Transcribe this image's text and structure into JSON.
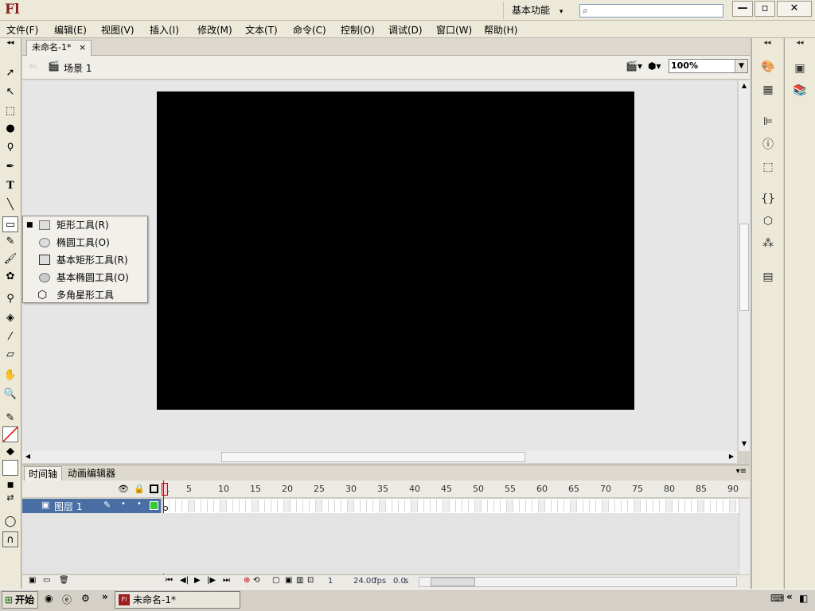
{
  "app": {
    "logo": "Fl",
    "workspace_label": "基本功能",
    "search_placeholder": ""
  },
  "window_controls": {
    "minimize": "—",
    "restore": "▫",
    "close": "✕"
  },
  "menubar": {
    "items": [
      "文件(F)",
      "编辑(E)",
      "视图(V)",
      "插入(I)",
      "修改(M)",
      "文本(T)",
      "命令(C)",
      "控制(O)",
      "调试(D)",
      "窗口(W)",
      "帮助(H)"
    ]
  },
  "document": {
    "tab_title": "未命名-1*",
    "tab_close": "×",
    "scene_label": "场景 1",
    "zoom": "100%"
  },
  "stage": {
    "background_color": "#000000"
  },
  "tool_popup": {
    "items": [
      {
        "label": "矩形工具(R)",
        "icon": "rectangle-icon",
        "selected": true
      },
      {
        "label": "椭圆工具(O)",
        "icon": "oval-icon",
        "selected": false
      },
      {
        "label": "基本矩形工具(R)",
        "icon": "primitive-rectangle-icon",
        "selected": false
      },
      {
        "label": "基本椭圆工具(O)",
        "icon": "primitive-oval-icon",
        "selected": false
      },
      {
        "label": "多角星形工具",
        "icon": "polystar-icon",
        "selected": false
      }
    ]
  },
  "timeline": {
    "tabs": [
      "时间轴",
      "动画编辑器"
    ],
    "frame_numbers": [
      "1",
      "5",
      "10",
      "15",
      "20",
      "25",
      "30",
      "35",
      "40",
      "45",
      "50",
      "55",
      "60",
      "65",
      "70",
      "75",
      "80",
      "85",
      "90"
    ],
    "layer_name": "图层 1",
    "current_frame": "1",
    "fps": "24.00",
    "fps_unit": "fps",
    "time": "0.0",
    "time_unit": "s"
  },
  "taskbar": {
    "start_label": "开始",
    "task_item": "未命名-1*",
    "arrows": "»",
    "tray_arrows": "«"
  },
  "colors": {
    "accent": "#4a6fa5",
    "stage": "#000000",
    "playhead": "#cc0000",
    "layer_swatch": "#33cc33"
  }
}
